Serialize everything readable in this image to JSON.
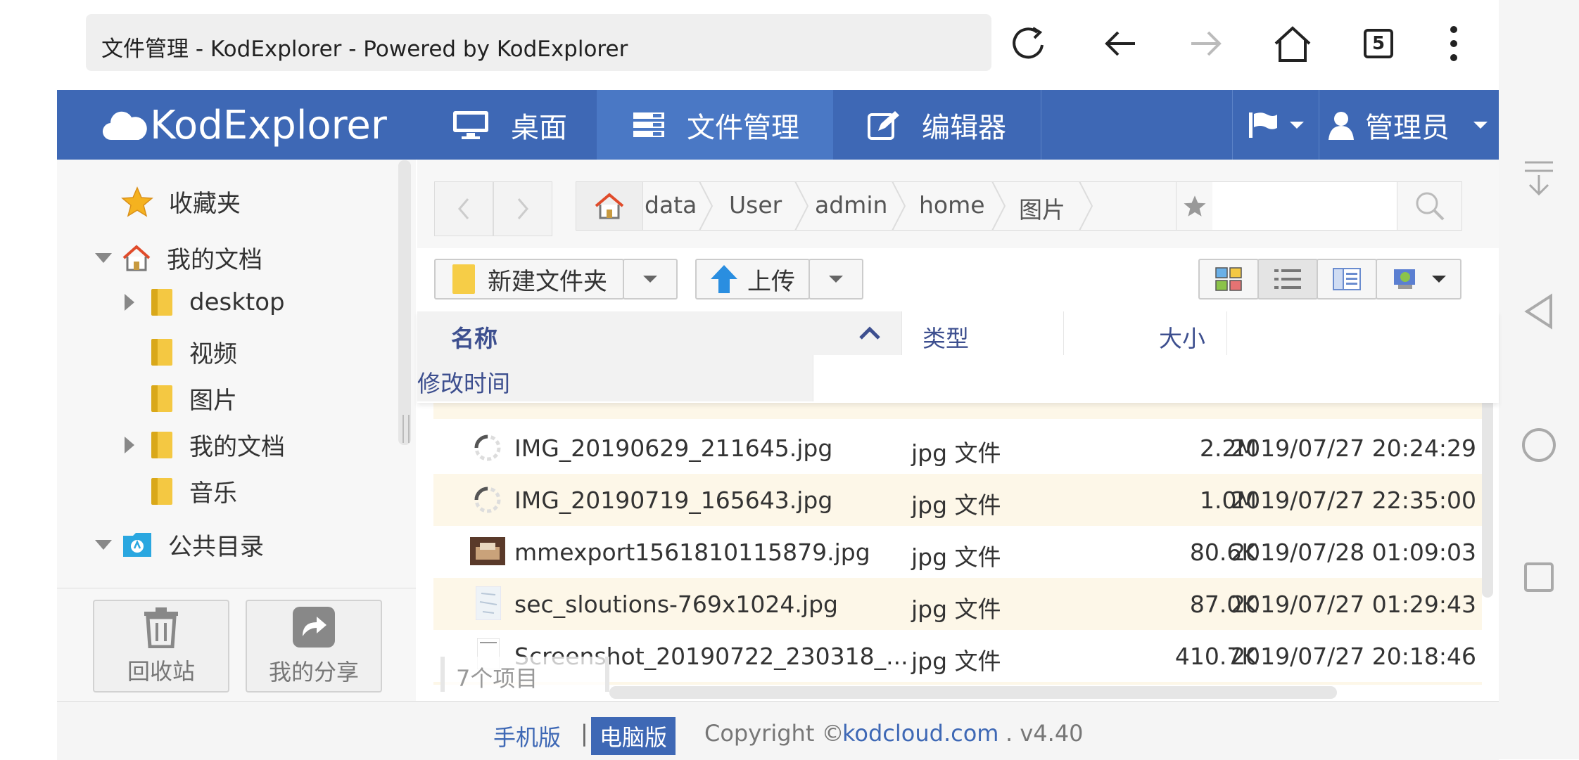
{
  "browser": {
    "title": "文件管理 - KodExplorer - Powered by KodExplorer",
    "tab_count": "5"
  },
  "header": {
    "logo_text": "KodExplorer",
    "nav": [
      {
        "label": "桌面",
        "icon": "monitor-icon"
      },
      {
        "label": "文件管理",
        "icon": "file-manager-icon"
      },
      {
        "label": "编辑器",
        "icon": "edit-icon"
      }
    ],
    "user_label": "管理员",
    "accent": "#3e68b5"
  },
  "sidebar": {
    "favorites": "收藏夹",
    "my_docs": "我的文档",
    "children": [
      "desktop",
      "视频",
      "图片",
      "我的文档",
      "音乐"
    ],
    "public": "公共目录",
    "recycle_label": "回收站",
    "share_label": "我的分享"
  },
  "pathbar": {
    "crumbs": [
      "data",
      "User",
      "admin",
      "home",
      "图片"
    ]
  },
  "toolbar": {
    "new_folder": "新建文件夹",
    "upload": "上传"
  },
  "columns": {
    "name": "名称",
    "type": "类型",
    "size": "大小",
    "modified": "修改时间"
  },
  "files": [
    {
      "name": "IMG_20190629_211645.jpg",
      "type": "jpg 文件",
      "size": "2.2M",
      "date": "2019/07/27 20:24:29",
      "thumb": "loading"
    },
    {
      "name": "IMG_20190719_165643.jpg",
      "type": "jpg 文件",
      "size": "1.0M",
      "date": "2019/07/27 22:35:00",
      "thumb": "loading"
    },
    {
      "name": "mmexport1561810115879.jpg",
      "type": "jpg 文件",
      "size": "80.6K",
      "date": "2019/07/28 01:09:03",
      "thumb": "photo"
    },
    {
      "name": "sec_sloutions-769x1024.jpg",
      "type": "jpg 文件",
      "size": "87.0K",
      "date": "2019/07/27 01:29:43",
      "thumb": "doc"
    },
    {
      "name": "Screenshot_20190722_230318_...",
      "type": "jpg 文件",
      "size": "410.7K",
      "date": "2019/07/27 20:18:46",
      "thumb": "doc"
    }
  ],
  "status": {
    "item_count": "7个项目"
  },
  "footer": {
    "mobile": "手机版",
    "sep": "|",
    "desktop": "电脑版",
    "copyright_prefix": "Copyright ©",
    "site": "kodcloud.com",
    "version": ". v4.40"
  }
}
